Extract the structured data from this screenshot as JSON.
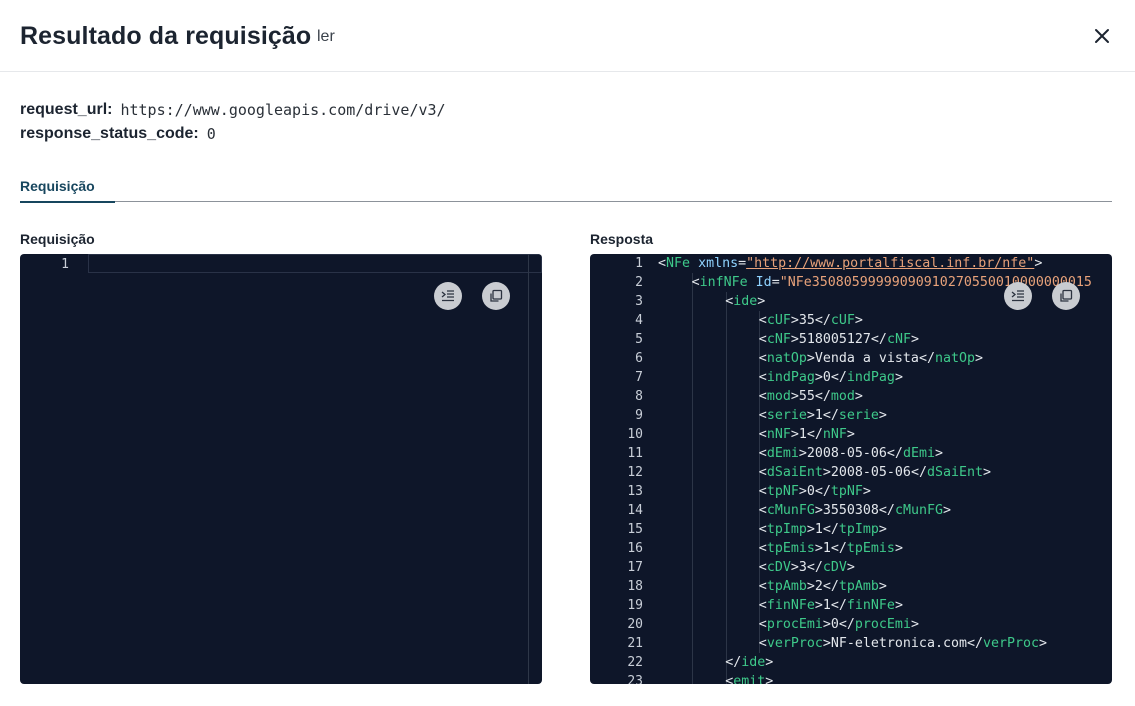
{
  "header": {
    "title": "Resultado da requisição",
    "subtitle": "ler"
  },
  "meta": [
    {
      "key": "request_url:",
      "value": "https://www.googleapis.com/drive/v3/"
    },
    {
      "key": "response_status_code:",
      "value": "0"
    }
  ],
  "tabs": [
    {
      "label": "Requisição"
    }
  ],
  "request": {
    "label": "Requisição",
    "line_numbers": [
      "1"
    ]
  },
  "response": {
    "label": "Resposta",
    "lines": [
      {
        "n": "1",
        "indent": 0,
        "tokens": [
          [
            "<",
            "br"
          ],
          [
            "NFe",
            "tag"
          ],
          [
            " ",
            "text"
          ],
          [
            "xmlns",
            "attr"
          ],
          [
            "=",
            "br"
          ],
          [
            "\"http://www.portalfiscal.inf.br/nfe\"",
            "str"
          ],
          [
            ">",
            "br"
          ]
        ]
      },
      {
        "n": "2",
        "indent": 1,
        "tokens": [
          [
            "<",
            "br"
          ],
          [
            "infNFe",
            "tag"
          ],
          [
            " ",
            "text"
          ],
          [
            "Id",
            "attr"
          ],
          [
            "=",
            "br"
          ],
          [
            "\"NFe35080599999090910270550010000000015",
            "str2"
          ]
        ]
      },
      {
        "n": "3",
        "indent": 2,
        "tokens": [
          [
            "<",
            "br"
          ],
          [
            "ide",
            "tag"
          ],
          [
            ">",
            "br"
          ]
        ]
      },
      {
        "n": "4",
        "indent": 3,
        "tokens": [
          [
            "<",
            "br"
          ],
          [
            "cUF",
            "tag"
          ],
          [
            ">",
            "br"
          ],
          [
            "35",
            "text"
          ],
          [
            "</",
            "br"
          ],
          [
            "cUF",
            "tag"
          ],
          [
            ">",
            "br"
          ]
        ]
      },
      {
        "n": "5",
        "indent": 3,
        "tokens": [
          [
            "<",
            "br"
          ],
          [
            "cNF",
            "tag"
          ],
          [
            ">",
            "br"
          ],
          [
            "518005127",
            "text"
          ],
          [
            "</",
            "br"
          ],
          [
            "cNF",
            "tag"
          ],
          [
            ">",
            "br"
          ]
        ]
      },
      {
        "n": "6",
        "indent": 3,
        "tokens": [
          [
            "<",
            "br"
          ],
          [
            "natOp",
            "tag"
          ],
          [
            ">",
            "br"
          ],
          [
            "Venda a vista",
            "text"
          ],
          [
            "</",
            "br"
          ],
          [
            "natOp",
            "tag"
          ],
          [
            ">",
            "br"
          ]
        ]
      },
      {
        "n": "7",
        "indent": 3,
        "tokens": [
          [
            "<",
            "br"
          ],
          [
            "indPag",
            "tag"
          ],
          [
            ">",
            "br"
          ],
          [
            "0",
            "text"
          ],
          [
            "</",
            "br"
          ],
          [
            "indPag",
            "tag"
          ],
          [
            ">",
            "br"
          ]
        ]
      },
      {
        "n": "8",
        "indent": 3,
        "tokens": [
          [
            "<",
            "br"
          ],
          [
            "mod",
            "tag"
          ],
          [
            ">",
            "br"
          ],
          [
            "55",
            "text"
          ],
          [
            "</",
            "br"
          ],
          [
            "mod",
            "tag"
          ],
          [
            ">",
            "br"
          ]
        ]
      },
      {
        "n": "9",
        "indent": 3,
        "tokens": [
          [
            "<",
            "br"
          ],
          [
            "serie",
            "tag"
          ],
          [
            ">",
            "br"
          ],
          [
            "1",
            "text"
          ],
          [
            "</",
            "br"
          ],
          [
            "serie",
            "tag"
          ],
          [
            ">",
            "br"
          ]
        ]
      },
      {
        "n": "10",
        "indent": 3,
        "tokens": [
          [
            "<",
            "br"
          ],
          [
            "nNF",
            "tag"
          ],
          [
            ">",
            "br"
          ],
          [
            "1",
            "text"
          ],
          [
            "</",
            "br"
          ],
          [
            "nNF",
            "tag"
          ],
          [
            ">",
            "br"
          ]
        ]
      },
      {
        "n": "11",
        "indent": 3,
        "tokens": [
          [
            "<",
            "br"
          ],
          [
            "dEmi",
            "tag"
          ],
          [
            ">",
            "br"
          ],
          [
            "2008-05-06",
            "text"
          ],
          [
            "</",
            "br"
          ],
          [
            "dEmi",
            "tag"
          ],
          [
            ">",
            "br"
          ]
        ]
      },
      {
        "n": "12",
        "indent": 3,
        "tokens": [
          [
            "<",
            "br"
          ],
          [
            "dSaiEnt",
            "tag"
          ],
          [
            ">",
            "br"
          ],
          [
            "2008-05-06",
            "text"
          ],
          [
            "</",
            "br"
          ],
          [
            "dSaiEnt",
            "tag"
          ],
          [
            ">",
            "br"
          ]
        ]
      },
      {
        "n": "13",
        "indent": 3,
        "tokens": [
          [
            "<",
            "br"
          ],
          [
            "tpNF",
            "tag"
          ],
          [
            ">",
            "br"
          ],
          [
            "0",
            "text"
          ],
          [
            "</",
            "br"
          ],
          [
            "tpNF",
            "tag"
          ],
          [
            ">",
            "br"
          ]
        ]
      },
      {
        "n": "14",
        "indent": 3,
        "tokens": [
          [
            "<",
            "br"
          ],
          [
            "cMunFG",
            "tag"
          ],
          [
            ">",
            "br"
          ],
          [
            "3550308",
            "text"
          ],
          [
            "</",
            "br"
          ],
          [
            "cMunFG",
            "tag"
          ],
          [
            ">",
            "br"
          ]
        ]
      },
      {
        "n": "15",
        "indent": 3,
        "tokens": [
          [
            "<",
            "br"
          ],
          [
            "tpImp",
            "tag"
          ],
          [
            ">",
            "br"
          ],
          [
            "1",
            "text"
          ],
          [
            "</",
            "br"
          ],
          [
            "tpImp",
            "tag"
          ],
          [
            ">",
            "br"
          ]
        ]
      },
      {
        "n": "16",
        "indent": 3,
        "tokens": [
          [
            "<",
            "br"
          ],
          [
            "tpEmis",
            "tag"
          ],
          [
            ">",
            "br"
          ],
          [
            "1",
            "text"
          ],
          [
            "</",
            "br"
          ],
          [
            "tpEmis",
            "tag"
          ],
          [
            ">",
            "br"
          ]
        ]
      },
      {
        "n": "17",
        "indent": 3,
        "tokens": [
          [
            "<",
            "br"
          ],
          [
            "cDV",
            "tag"
          ],
          [
            ">",
            "br"
          ],
          [
            "3",
            "text"
          ],
          [
            "</",
            "br"
          ],
          [
            "cDV",
            "tag"
          ],
          [
            ">",
            "br"
          ]
        ]
      },
      {
        "n": "18",
        "indent": 3,
        "tokens": [
          [
            "<",
            "br"
          ],
          [
            "tpAmb",
            "tag"
          ],
          [
            ">",
            "br"
          ],
          [
            "2",
            "text"
          ],
          [
            "</",
            "br"
          ],
          [
            "tpAmb",
            "tag"
          ],
          [
            ">",
            "br"
          ]
        ]
      },
      {
        "n": "19",
        "indent": 3,
        "tokens": [
          [
            "<",
            "br"
          ],
          [
            "finNFe",
            "tag"
          ],
          [
            ">",
            "br"
          ],
          [
            "1",
            "text"
          ],
          [
            "</",
            "br"
          ],
          [
            "finNFe",
            "tag"
          ],
          [
            ">",
            "br"
          ]
        ]
      },
      {
        "n": "20",
        "indent": 3,
        "tokens": [
          [
            "<",
            "br"
          ],
          [
            "procEmi",
            "tag"
          ],
          [
            ">",
            "br"
          ],
          [
            "0",
            "text"
          ],
          [
            "</",
            "br"
          ],
          [
            "procEmi",
            "tag"
          ],
          [
            ">",
            "br"
          ]
        ]
      },
      {
        "n": "21",
        "indent": 3,
        "tokens": [
          [
            "<",
            "br"
          ],
          [
            "verProc",
            "tag"
          ],
          [
            ">",
            "br"
          ],
          [
            "NF-eletronica.com",
            "text"
          ],
          [
            "</",
            "br"
          ],
          [
            "verProc",
            "tag"
          ],
          [
            ">",
            "br"
          ]
        ]
      },
      {
        "n": "22",
        "indent": 2,
        "tokens": [
          [
            "</",
            "br"
          ],
          [
            "ide",
            "tag"
          ],
          [
            ">",
            "br"
          ]
        ]
      },
      {
        "n": "23",
        "indent": 2,
        "tokens": [
          [
            "<",
            "br"
          ],
          [
            "emit",
            "tag"
          ],
          [
            ">",
            "br"
          ]
        ]
      }
    ]
  },
  "icons": {
    "close": "close-icon",
    "format": "format-icon",
    "copy": "copy-icon"
  },
  "colors": {
    "editor_bg": "#0e1629",
    "tag": "#3ec98a",
    "attr": "#8fd3ff",
    "string": "#e8a27a",
    "tab_active": "#17465e"
  }
}
